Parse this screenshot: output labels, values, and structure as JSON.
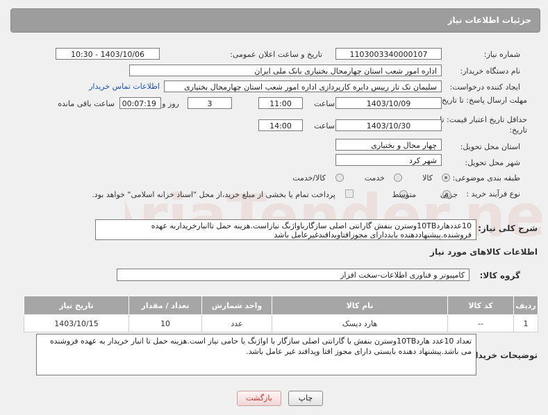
{
  "panel": {
    "title": "جزئیات اطلاعات نیاز"
  },
  "labels": {
    "need_number": "شماره نیاز:",
    "announce_datetime": "تاریخ و ساعت اعلان عمومی:",
    "buyer_org": "نام دستگاه خریدار:",
    "requester": "ایجاد کننده درخواست:",
    "reply_deadline": "مهلت ارسال پاسخ: تا تاریخ:",
    "price_validity": "حداقل تاریخ اعتبار قیمت: تا تاریخ:",
    "time": "ساعت",
    "days_and": "روز و",
    "remaining": "ساعت باقی مانده",
    "delivery_province": "استان محل تحویل:",
    "delivery_city": "شهر محل تحویل:",
    "subject_class": "طبقه بندی موضوعی:",
    "purchase_type": "نوع فرآیند خرید :",
    "general_desc": "شرح کلی نیاز:",
    "goods_info": "اطلاعات کالاهای مورد نیاز",
    "goods_group": "گروه کالا:",
    "buyer_notes": "توضیحات خریدار:"
  },
  "fields": {
    "need_number": "1103003340000107",
    "announce_datetime": "1403/10/06 - 10:30",
    "buyer_org": "اداره امور شعب استان چهارمحال بختیاری بانک ملی ایران",
    "requester": "سلیمان تک تاز رییس دایره کارپردازی  اداره امور شعب استان چهارمحال بختیاری",
    "contact_link": "اطلاعات تماس خریدار",
    "reply_date": "1403/10/09",
    "reply_time": "11:00",
    "reply_days": "3",
    "reply_remaining": "00:07:19",
    "validity_date": "1403/10/30",
    "validity_time": "14:00",
    "delivery_province": "چهار محال و بختیاری",
    "delivery_city": "شهر کرد"
  },
  "subject_options": [
    {
      "label": "کالا",
      "selected": true
    },
    {
      "label": "خدمت",
      "selected": false
    },
    {
      "label": "کالا/خدمت",
      "selected": false
    }
  ],
  "purchase_options": [
    {
      "label": "جزیی",
      "selected": true
    },
    {
      "label": "متوسط",
      "selected": false
    }
  ],
  "payment_note": "پرداخت تمام یا بخشی از مبلغ خرید،از محل \"اسناد خزانه اسلامی\" خواهد بود.",
  "general_desc": "10عددهارد10TBوسترن بنفش گارانتی اصلی سازگارباواژنگ نیازاست.هزینه حمل تاانبارخریداربه عهده فروشنده.پیشنهاددهنده بایددارای مجوزافتاویدافندغیرعامل باشد",
  "goods_group": "کامپیوتر و فناوری اطلاعات-سخت افزار",
  "table": {
    "headers": [
      "ردیف",
      "کد کالا",
      "نام کالا",
      "واحد شمارش",
      "تعداد / مقدار",
      "تاریخ نیاز"
    ],
    "rows": [
      [
        "1",
        "--",
        "هارد دیسک",
        "عدد",
        "10",
        "1403/10/15"
      ]
    ]
  },
  "buyer_notes": "تعداد 10عدد هارد10TBوسترن بنفش با گارانتی اصلی سازگار با اواژنگ یا حامی نیاز است.هزینه حمل تا انبار خریدار به عهده فروشنده می باشد.پیشنهاد دهنده بایستی دارای مجوز افتا وپدافند غیر عامل باشد.",
  "buttons": {
    "print": "چاپ",
    "back": "بازگشت"
  },
  "watermark_text": "AriaTender.net",
  "colors": {
    "panel": "#9d9d9d",
    "link": "#1a56b8",
    "back_text": "#c0392b"
  }
}
